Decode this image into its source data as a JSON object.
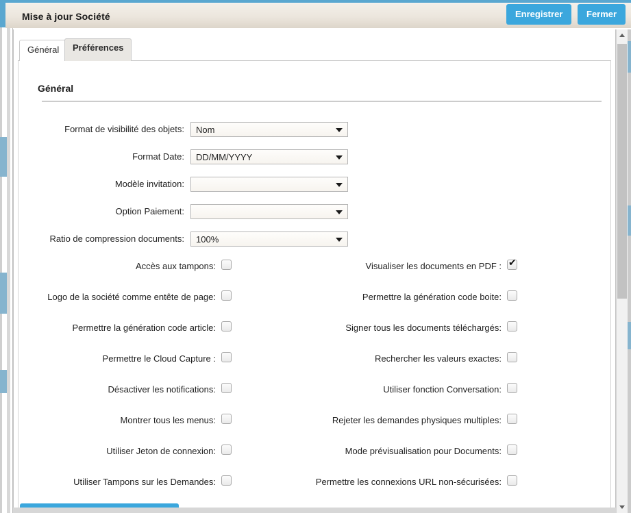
{
  "header": {
    "title": "Mise à jour Société",
    "save_label": "Enregistrer",
    "close_label": "Fermer"
  },
  "tabs": [
    {
      "label": "Général",
      "active": false
    },
    {
      "label": "Préférences",
      "active": true
    }
  ],
  "section": {
    "title": "Général"
  },
  "selects": [
    {
      "label": "Format de visibilité des objets:",
      "value": "Nom"
    },
    {
      "label": "Format Date:",
      "value": "DD/MM/YYYY"
    },
    {
      "label": "Modèle invitation:",
      "value": ""
    },
    {
      "label": "Option Paiement:",
      "value": ""
    },
    {
      "label": "Ratio de compression documents:",
      "value": "100%"
    }
  ],
  "checkboxes_left": [
    {
      "label": "Accès aux tampons:",
      "checked": false
    },
    {
      "label": "Logo de la société comme entête de page:",
      "checked": false
    },
    {
      "label": "Permettre la génération code article:",
      "checked": false
    },
    {
      "label": "Permettre le Cloud Capture :",
      "checked": false
    },
    {
      "label": "Désactiver les notifications:",
      "checked": false
    },
    {
      "label": "Montrer tous les menus:",
      "checked": false
    },
    {
      "label": "Utiliser Jeton de connexion:",
      "checked": false
    },
    {
      "label": "Utiliser Tampons sur les Demandes:",
      "checked": false
    }
  ],
  "checkboxes_right": [
    {
      "label": "Visualiser les documents en PDF :",
      "checked": true
    },
    {
      "label": "Permettre la génération code boite:",
      "checked": false
    },
    {
      "label": "Signer tous les documents téléchargés:",
      "checked": false
    },
    {
      "label": "Rechercher les valeurs exactes:",
      "checked": false
    },
    {
      "label": "Utiliser fonction Conversation:",
      "checked": false
    },
    {
      "label": "Rejeter les demandes physiques multiples:",
      "checked": false
    },
    {
      "label": "Mode prévisualisation pour Documents:",
      "checked": false
    },
    {
      "label": "Permettre les connexions URL non-sécurisées:",
      "checked": false
    }
  ],
  "icons": {
    "select_arrow": "chevron-down-icon",
    "scroll_up": "scroll-up-arrow-icon",
    "scroll_down": "scroll-down-arrow-icon",
    "checkmark": "✔"
  },
  "colors": {
    "accent": "#3ba7dd",
    "header_band": "#5aa7d0",
    "active_tab": "#e9e7e3"
  }
}
